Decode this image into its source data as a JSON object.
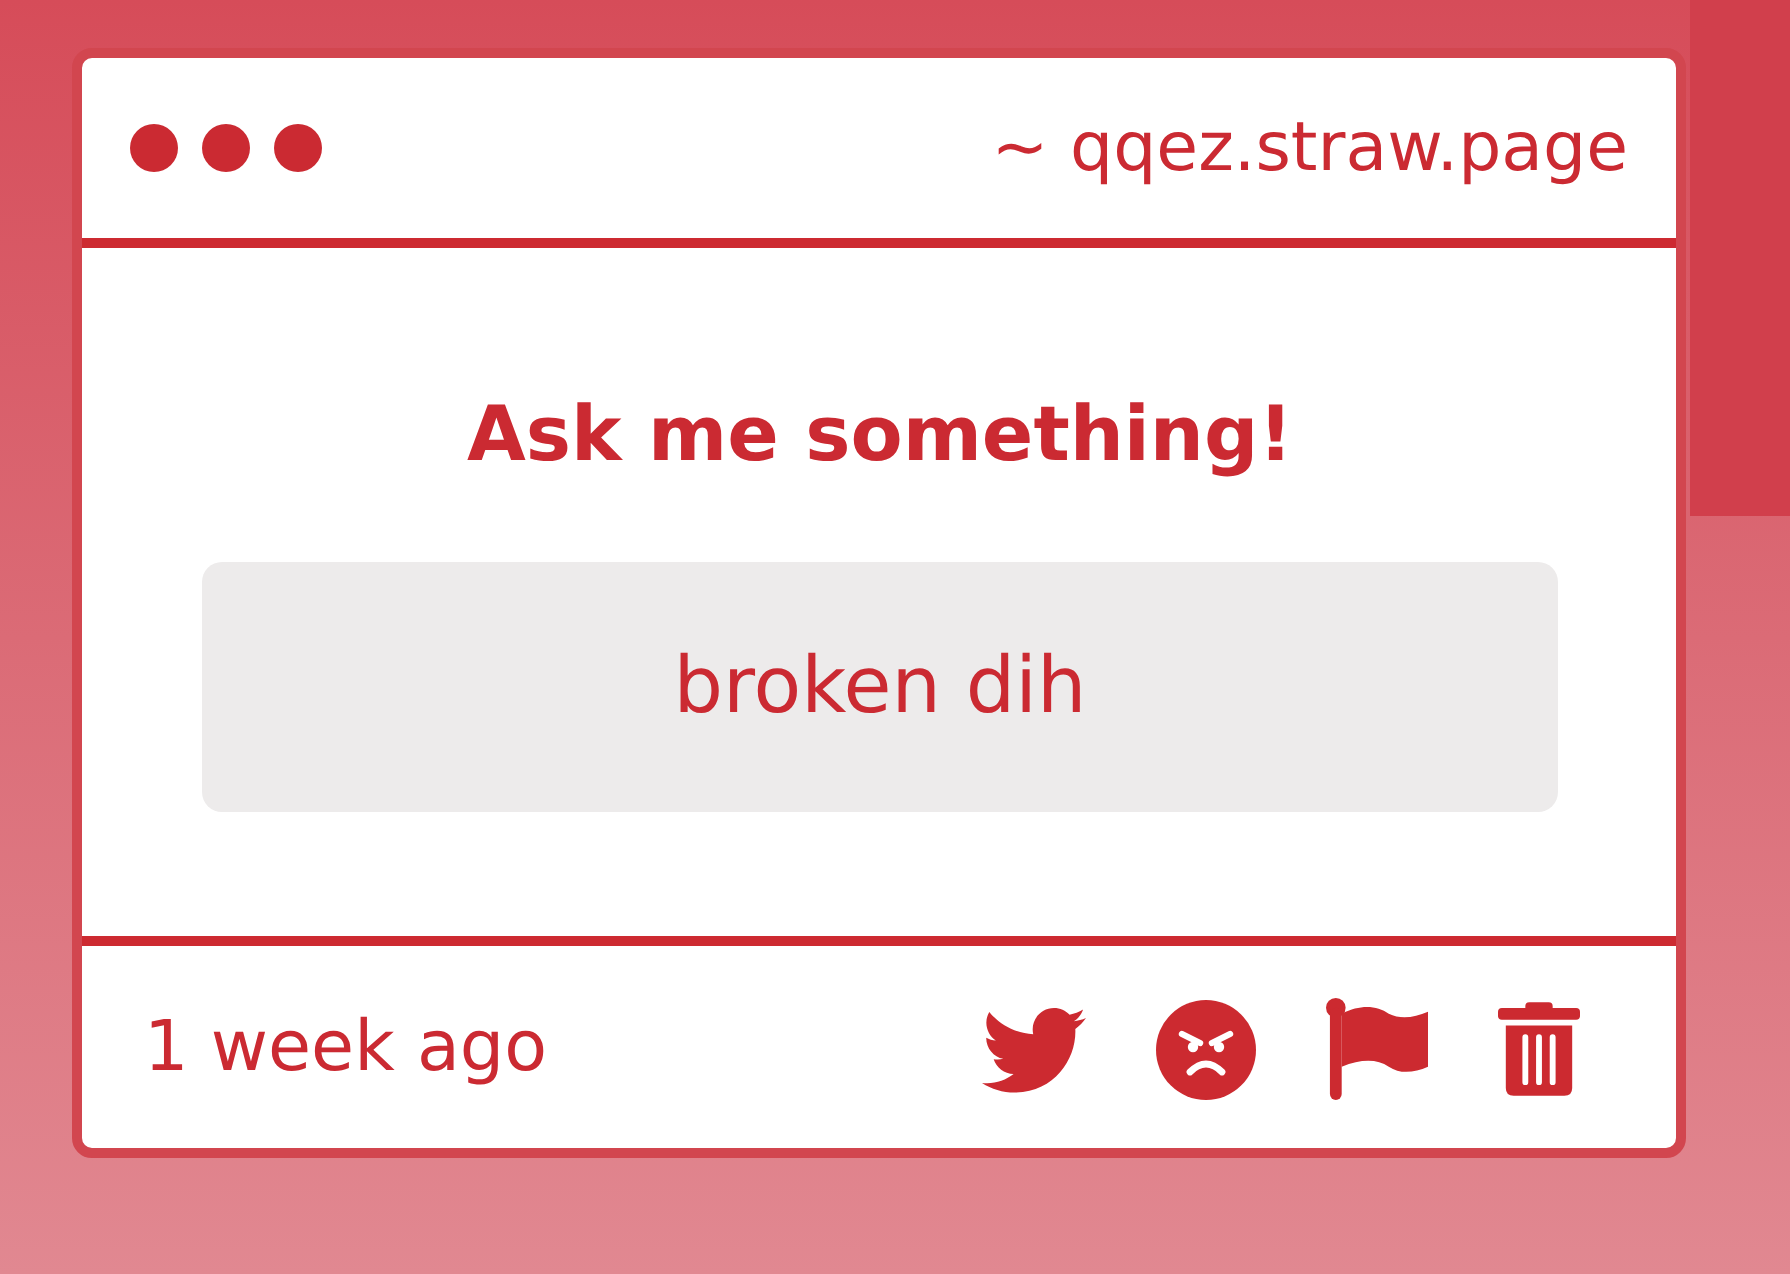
{
  "window": {
    "url": "~ qqez.straw.page"
  },
  "question": {
    "heading": "Ask me something!",
    "text": "broken dih"
  },
  "footer": {
    "timestamp": "1 week ago"
  }
}
